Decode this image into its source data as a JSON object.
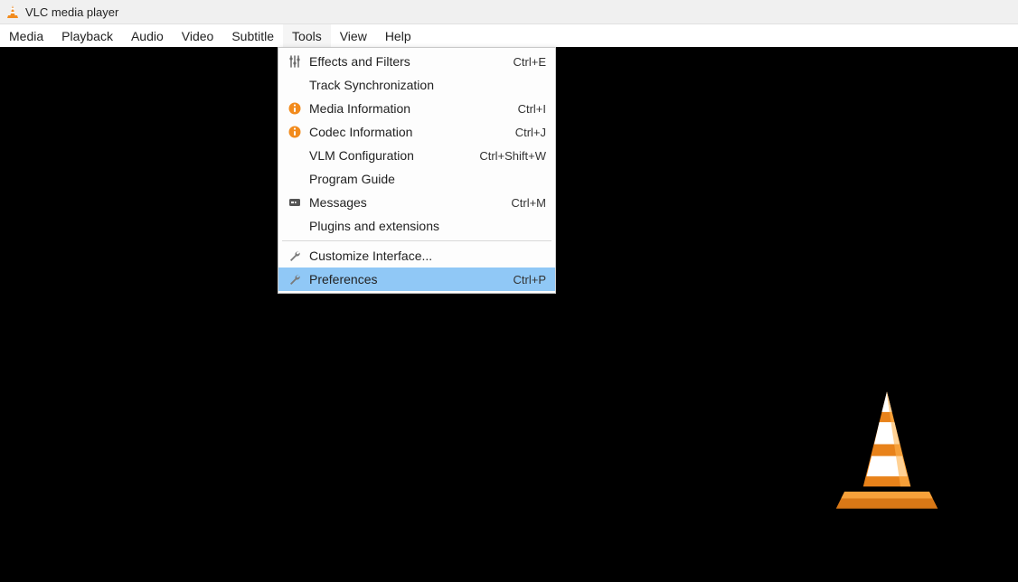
{
  "window": {
    "title": "VLC media player"
  },
  "menubar": {
    "items": [
      {
        "label": "Media"
      },
      {
        "label": "Playback"
      },
      {
        "label": "Audio"
      },
      {
        "label": "Video"
      },
      {
        "label": "Subtitle"
      },
      {
        "label": "Tools"
      },
      {
        "label": "View"
      },
      {
        "label": "Help"
      }
    ],
    "open_index": 5
  },
  "tools_menu": {
    "items": [
      {
        "icon": "sliders-icon",
        "label": "Effects and Filters",
        "shortcut": "Ctrl+E"
      },
      {
        "icon": "",
        "label": "Track Synchronization",
        "shortcut": ""
      },
      {
        "icon": "info-icon",
        "label": "Media Information",
        "shortcut": "Ctrl+I"
      },
      {
        "icon": "info-icon",
        "label": "Codec Information",
        "shortcut": "Ctrl+J"
      },
      {
        "icon": "",
        "label": "VLM Configuration",
        "shortcut": "Ctrl+Shift+W"
      },
      {
        "icon": "",
        "label": "Program Guide",
        "shortcut": ""
      },
      {
        "icon": "messages-icon",
        "label": "Messages",
        "shortcut": "Ctrl+M"
      },
      {
        "icon": "",
        "label": "Plugins and extensions",
        "shortcut": ""
      },
      {
        "separator": true
      },
      {
        "icon": "wrench-icon",
        "label": "Customize Interface...",
        "shortcut": ""
      },
      {
        "icon": "wrench-icon",
        "label": "Preferences",
        "shortcut": "Ctrl+P",
        "highlight": true
      }
    ]
  }
}
